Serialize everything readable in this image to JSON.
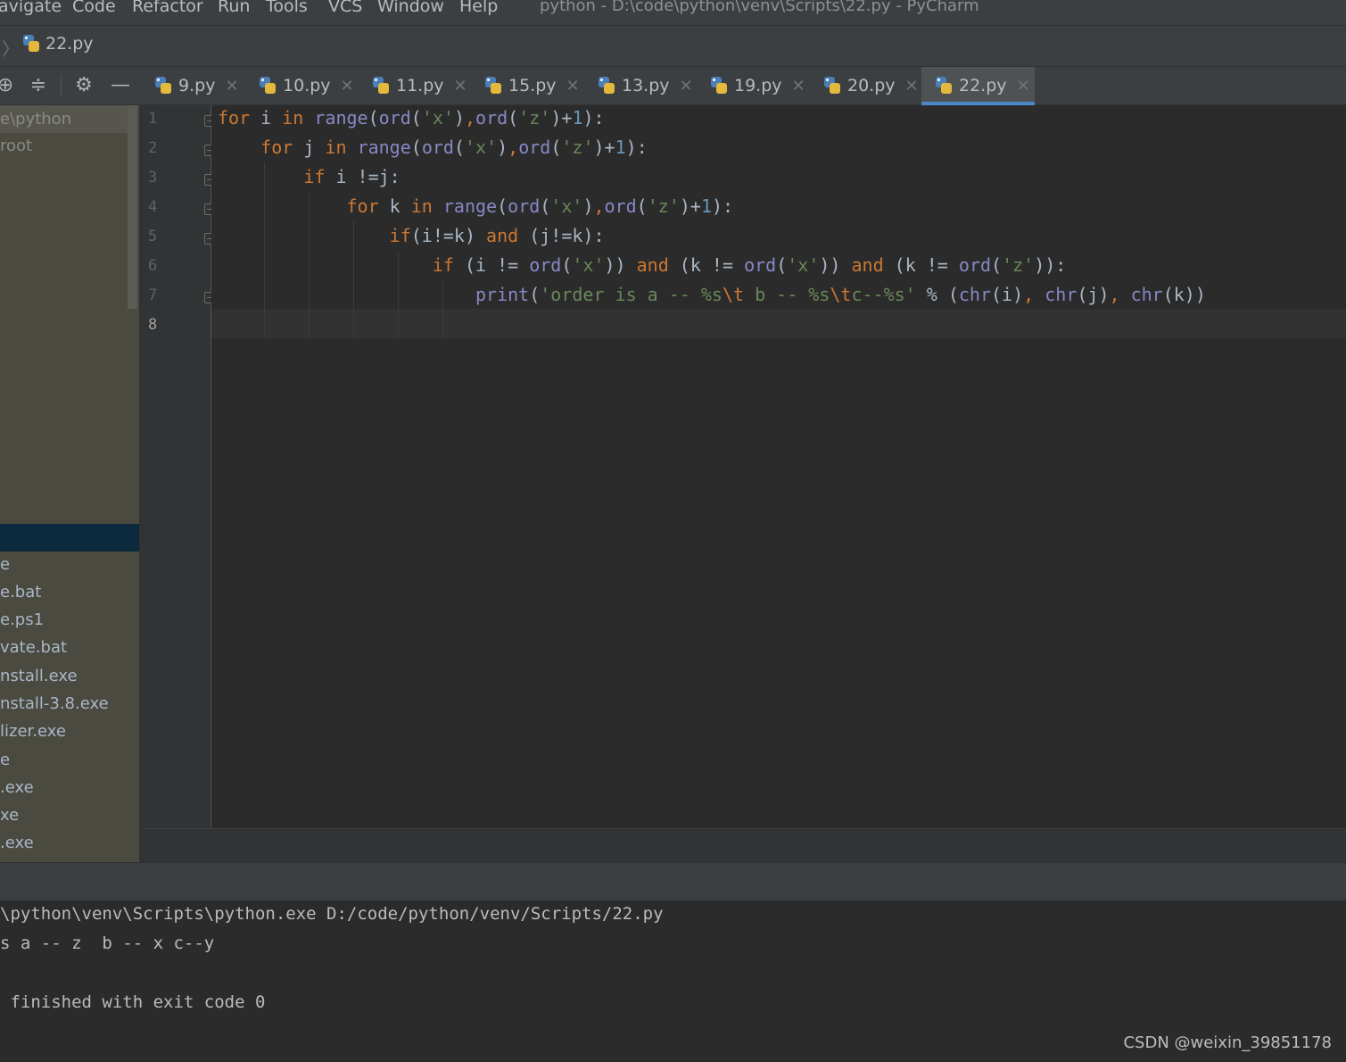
{
  "menubar": {
    "items": [
      "avigate",
      "Code",
      "Refactor",
      "Run",
      "Tools",
      "VCS",
      "Window",
      "Help"
    ],
    "window_title": "python - D:\\code\\python\\venv\\Scripts\\22.py - PyCharm"
  },
  "navbar": {
    "file": "22.py"
  },
  "toolbar": {
    "icons": [
      "locate-icon",
      "collapse-all-icon",
      "gear-icon",
      "hide-icon"
    ]
  },
  "tabs": [
    {
      "label": "9.py",
      "active": false
    },
    {
      "label": "10.py",
      "active": false
    },
    {
      "label": "11.py",
      "active": false
    },
    {
      "label": "15.py",
      "active": false
    },
    {
      "label": "13.py",
      "active": false
    },
    {
      "label": "19.py",
      "active": false
    },
    {
      "label": "20.py",
      "active": false
    },
    {
      "label": "22.py",
      "active": true
    }
  ],
  "project_tree": {
    "top_items": [
      "e\\python",
      "root"
    ],
    "files": [
      "e",
      "e.bat",
      "e.ps1",
      "vate.bat",
      "nstall.exe",
      "nstall-3.8.exe",
      "lizer.exe",
      "e",
      ".exe",
      "xe",
      ".exe"
    ]
  },
  "editor": {
    "line_numbers": [
      "1",
      "2",
      "3",
      "4",
      "5",
      "6",
      "7",
      "8"
    ],
    "current_line": 8,
    "lines": [
      [
        {
          "t": "for",
          "c": "kw"
        },
        {
          "t": " i ",
          "c": "tx"
        },
        {
          "t": "in",
          "c": "kw"
        },
        {
          "t": " ",
          "c": "tx"
        },
        {
          "t": "range",
          "c": "bi"
        },
        {
          "t": "(",
          "c": "tx"
        },
        {
          "t": "ord",
          "c": "bi"
        },
        {
          "t": "(",
          "c": "tx"
        },
        {
          "t": "'x'",
          "c": "st"
        },
        {
          "t": ")",
          "c": "tx"
        },
        {
          "t": ",",
          "c": "kw"
        },
        {
          "t": "ord",
          "c": "bi"
        },
        {
          "t": "(",
          "c": "tx"
        },
        {
          "t": "'z'",
          "c": "st"
        },
        {
          "t": ")+",
          "c": "tx"
        },
        {
          "t": "1",
          "c": "nu"
        },
        {
          "t": "):",
          "c": "tx"
        }
      ],
      [
        {
          "t": "    ",
          "c": "tx"
        },
        {
          "t": "for",
          "c": "kw"
        },
        {
          "t": " j ",
          "c": "tx"
        },
        {
          "t": "in",
          "c": "kw"
        },
        {
          "t": " ",
          "c": "tx"
        },
        {
          "t": "range",
          "c": "bi"
        },
        {
          "t": "(",
          "c": "tx"
        },
        {
          "t": "ord",
          "c": "bi"
        },
        {
          "t": "(",
          "c": "tx"
        },
        {
          "t": "'x'",
          "c": "st"
        },
        {
          "t": ")",
          "c": "tx"
        },
        {
          "t": ",",
          "c": "kw"
        },
        {
          "t": "ord",
          "c": "bi"
        },
        {
          "t": "(",
          "c": "tx"
        },
        {
          "t": "'z'",
          "c": "st"
        },
        {
          "t": ")+",
          "c": "tx"
        },
        {
          "t": "1",
          "c": "nu"
        },
        {
          "t": "):",
          "c": "tx"
        }
      ],
      [
        {
          "t": "        ",
          "c": "tx"
        },
        {
          "t": "if",
          "c": "kw"
        },
        {
          "t": " i !=j:",
          "c": "tx"
        }
      ],
      [
        {
          "t": "            ",
          "c": "tx"
        },
        {
          "t": "for",
          "c": "kw"
        },
        {
          "t": " k ",
          "c": "tx"
        },
        {
          "t": "in",
          "c": "kw"
        },
        {
          "t": " ",
          "c": "tx"
        },
        {
          "t": "range",
          "c": "bi"
        },
        {
          "t": "(",
          "c": "tx"
        },
        {
          "t": "ord",
          "c": "bi"
        },
        {
          "t": "(",
          "c": "tx"
        },
        {
          "t": "'x'",
          "c": "st"
        },
        {
          "t": ")",
          "c": "tx"
        },
        {
          "t": ",",
          "c": "kw"
        },
        {
          "t": "ord",
          "c": "bi"
        },
        {
          "t": "(",
          "c": "tx"
        },
        {
          "t": "'z'",
          "c": "st"
        },
        {
          "t": ")+",
          "c": "tx"
        },
        {
          "t": "1",
          "c": "nu"
        },
        {
          "t": "):",
          "c": "tx"
        }
      ],
      [
        {
          "t": "                ",
          "c": "tx"
        },
        {
          "t": "if",
          "c": "kw"
        },
        {
          "t": "(i!=k) ",
          "c": "tx"
        },
        {
          "t": "and",
          "c": "kw"
        },
        {
          "t": " (j!=k):",
          "c": "tx"
        }
      ],
      [
        {
          "t": "                    ",
          "c": "tx"
        },
        {
          "t": "if",
          "c": "kw"
        },
        {
          "t": " (i != ",
          "c": "tx"
        },
        {
          "t": "ord",
          "c": "bi"
        },
        {
          "t": "(",
          "c": "tx"
        },
        {
          "t": "'x'",
          "c": "st"
        },
        {
          "t": ")) ",
          "c": "tx"
        },
        {
          "t": "and",
          "c": "kw"
        },
        {
          "t": " (k != ",
          "c": "tx"
        },
        {
          "t": "ord",
          "c": "bi"
        },
        {
          "t": "(",
          "c": "tx"
        },
        {
          "t": "'x'",
          "c": "st"
        },
        {
          "t": ")) ",
          "c": "tx"
        },
        {
          "t": "and",
          "c": "kw"
        },
        {
          "t": " (k != ",
          "c": "tx"
        },
        {
          "t": "ord",
          "c": "bi"
        },
        {
          "t": "(",
          "c": "tx"
        },
        {
          "t": "'z'",
          "c": "st"
        },
        {
          "t": ")):",
          "c": "tx"
        }
      ],
      [
        {
          "t": "                        ",
          "c": "tx"
        },
        {
          "t": "print",
          "c": "bi"
        },
        {
          "t": "(",
          "c": "tx"
        },
        {
          "t": "'order is a -- %s",
          "c": "st"
        },
        {
          "t": "\\t",
          "c": "es"
        },
        {
          "t": " b -- %s",
          "c": "st"
        },
        {
          "t": "\\t",
          "c": "es"
        },
        {
          "t": "c--%s'",
          "c": "st"
        },
        {
          "t": " % (",
          "c": "tx"
        },
        {
          "t": "chr",
          "c": "bi"
        },
        {
          "t": "(i)",
          "c": "tx"
        },
        {
          "t": ", ",
          "c": "kw"
        },
        {
          "t": "chr",
          "c": "bi"
        },
        {
          "t": "(j)",
          "c": "tx"
        },
        {
          "t": ", ",
          "c": "kw"
        },
        {
          "t": "chr",
          "c": "bi"
        },
        {
          "t": "(k))",
          "c": "tx"
        }
      ],
      []
    ]
  },
  "console": {
    "lines": [
      "\\python\\venv\\Scripts\\python.exe D:/code/python/venv/Scripts/22.py",
      "s a -- z  b -- x c--y",
      "",
      " finished with exit code 0"
    ]
  },
  "watermark": "CSDN @weixin_39851178",
  "colors": {
    "kw": "#cc7832",
    "tx": "#a9b7c6",
    "bi": "#8888c6",
    "st": "#6a8759",
    "nu": "#6897bb",
    "es": "#cc7832",
    "accent": "#4a88c7"
  }
}
